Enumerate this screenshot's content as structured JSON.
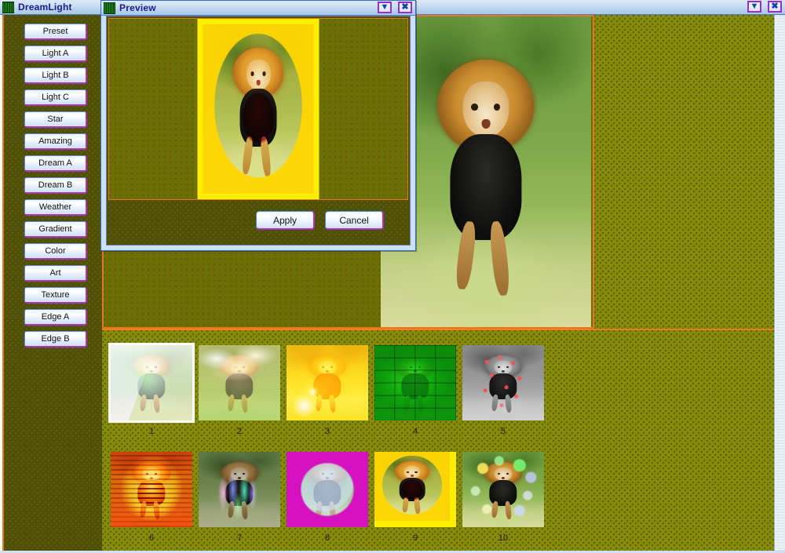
{
  "main_window": {
    "title": "DreamLight",
    "icon": "app-camo-icon",
    "buttons": [
      {
        "name": "collapse-button",
        "glyph": "▼"
      },
      {
        "name": "close-button",
        "glyph": "✖"
      }
    ]
  },
  "tool_panel": {
    "items": [
      {
        "label": "Preset"
      },
      {
        "label": "Light A"
      },
      {
        "label": "Light B"
      },
      {
        "label": "Light C"
      },
      {
        "label": "Star"
      },
      {
        "label": "Amazing"
      },
      {
        "label": "Dream A"
      },
      {
        "label": "Dream B"
      },
      {
        "label": "Weather"
      },
      {
        "label": "Gradient"
      },
      {
        "label": "Color"
      },
      {
        "label": "Art"
      },
      {
        "label": "Texture"
      },
      {
        "label": "Edge A"
      },
      {
        "label": "Edge B"
      }
    ]
  },
  "preview_dialog": {
    "title": "Preview",
    "icon": "app-camo-icon",
    "buttons": [
      {
        "name": "collapse-button",
        "glyph": "▼"
      },
      {
        "name": "close-button",
        "glyph": "✖"
      }
    ],
    "apply_label": "Apply",
    "cancel_label": "Cancel"
  },
  "thumbnails": {
    "row1": [
      {
        "label": "1",
        "style": "rainbow-white"
      },
      {
        "label": "2",
        "style": "cloud-warm"
      },
      {
        "label": "3",
        "style": "sun-orange"
      },
      {
        "label": "4",
        "style": "green-bricks"
      },
      {
        "label": "5",
        "style": "grayscale-red-sparks"
      }
    ],
    "row2": [
      {
        "label": "6",
        "style": "red-wall-glow"
      },
      {
        "label": "7",
        "style": "neon-flames"
      },
      {
        "label": "8",
        "style": "magenta-circle"
      },
      {
        "label": "9",
        "style": "yellow-oval-red-shirt"
      },
      {
        "label": "10",
        "style": "green-bokeh"
      }
    ]
  },
  "colors": {
    "background_olive": "#8a8a05",
    "panel_olive_dark": "#4f4f06",
    "accent_orange": "#e8761a",
    "titlebar_blue": "#a8c7ea",
    "button_border_purple": "#b030c0",
    "title_text": "#1a1a8c"
  }
}
